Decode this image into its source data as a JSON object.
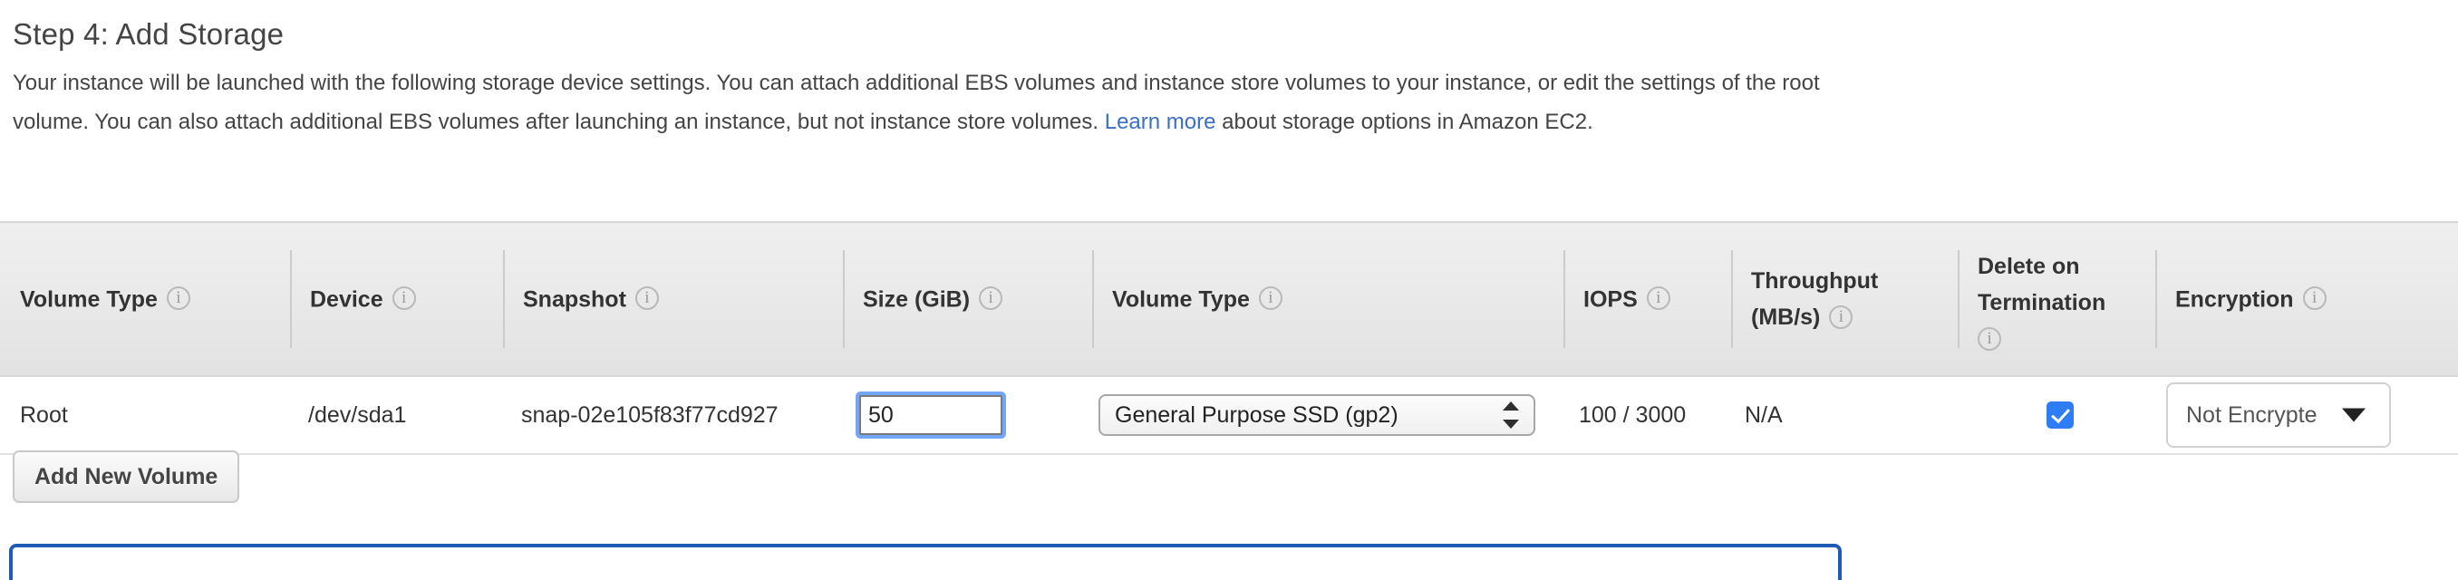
{
  "page": {
    "title": "Step 4: Add Storage",
    "intro_parts": {
      "before_link": "Your instance will be launched with the following storage device settings. You can attach additional EBS volumes and instance store volumes to your instance, or edit the settings of the root volume. You can also attach additional EBS volumes after launching an instance, but not instance store volumes. ",
      "link_text": "Learn more",
      "after_link": " about storage options in Amazon EC2."
    }
  },
  "colors": {
    "link": "#3b6ec4",
    "checkbox_checked": "#2f7df4",
    "focus_ring": "#5a96f5",
    "panel_border": "#1f5bb5",
    "header_bg": "#eaeaea",
    "text": "#333333"
  },
  "table": {
    "columns": [
      {
        "label": "Volume Type",
        "icon": "info-icon"
      },
      {
        "label": "Device",
        "icon": "info-icon"
      },
      {
        "label": "Snapshot",
        "icon": "info-icon"
      },
      {
        "label": "Size (GiB)",
        "icon": "info-icon"
      },
      {
        "label": "Volume Type",
        "icon": "info-icon"
      },
      {
        "label": "IOPS",
        "icon": "info-icon"
      },
      {
        "label": "Throughput (MB/s)",
        "line1": "Throughput",
        "line2": "(MB/s)",
        "icon": "info-icon"
      },
      {
        "label": "Delete on Termination",
        "line1": "Delete on",
        "line2": "Termination",
        "icon": "info-icon"
      },
      {
        "label": "Encryption",
        "icon": "info-icon"
      }
    ],
    "rows": [
      {
        "volume_type": "Root",
        "device": "/dev/sda1",
        "snapshot": "snap-02e105f83f77cd927",
        "size": "50",
        "size_placeholder": "",
        "volume_type_select": "General Purpose SSD (gp2)",
        "iops": "100 / 3000",
        "throughput": "N/A",
        "delete_on_termination": true,
        "encryption": "Not Encrypted",
        "encryption_display": "Not Encrypte"
      }
    ]
  },
  "buttons": {
    "add_new_volume": "Add New Volume"
  }
}
